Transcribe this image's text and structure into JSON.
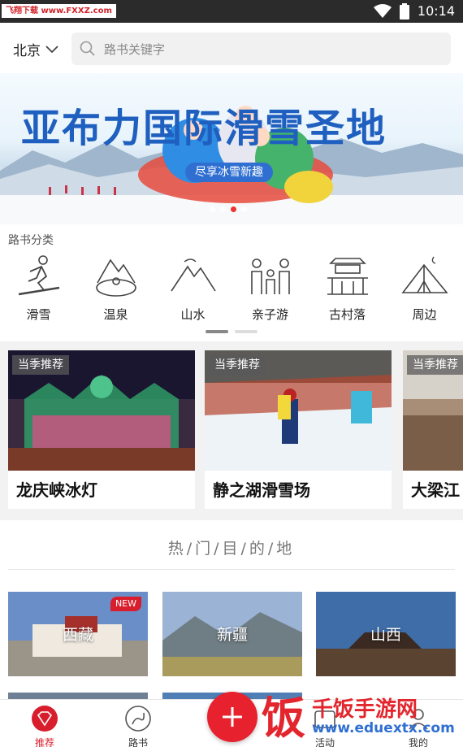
{
  "status_bar": {
    "watermark": "飞翔下载 www.FXXZ.com",
    "time": "10:14"
  },
  "header": {
    "city": "北京",
    "search_placeholder": "路书关键字"
  },
  "banner": {
    "title": "亚布力国际滑雪圣地",
    "subtitle": "尽享冰雪新趣",
    "dots": 4,
    "active_dot": 2
  },
  "categories": {
    "title": "路书分类",
    "items": [
      {
        "label": "滑雪",
        "icon": "skier-icon"
      },
      {
        "label": "温泉",
        "icon": "hot-spring-icon"
      },
      {
        "label": "山水",
        "icon": "mountain-icon"
      },
      {
        "label": "亲子游",
        "icon": "family-icon"
      },
      {
        "label": "古村落",
        "icon": "ancient-village-icon"
      },
      {
        "label": "周边",
        "icon": "tent-icon"
      }
    ]
  },
  "season": {
    "cards": [
      {
        "tag": "当季推荐",
        "name": "龙庆峡冰灯"
      },
      {
        "tag": "当季推荐",
        "name": "静之湖滑雪场"
      },
      {
        "tag": "当季推荐",
        "name": "大梁江"
      }
    ]
  },
  "hot": {
    "title": "热/门/目/的/地",
    "destinations": [
      {
        "name": "西藏",
        "badge": "NEW"
      },
      {
        "name": "新疆",
        "badge": ""
      },
      {
        "name": "山西",
        "badge": ""
      }
    ]
  },
  "bottom_nav": {
    "items": [
      {
        "label": "推荐",
        "icon": "diamond-icon",
        "active": true
      },
      {
        "label": "路书",
        "icon": "route-icon",
        "active": false
      },
      {
        "label": "活动",
        "icon": "activity-icon",
        "active": false
      },
      {
        "label": "我的",
        "icon": "profile-icon",
        "active": false
      }
    ]
  },
  "watermark_bottom": {
    "text": "千饭手游网",
    "url": "www.eduextx.com",
    "logo": "饭"
  },
  "colors": {
    "accent": "#e8212f",
    "banner_title": "#1f5fbf",
    "status_bar": "#2b2b2b"
  }
}
